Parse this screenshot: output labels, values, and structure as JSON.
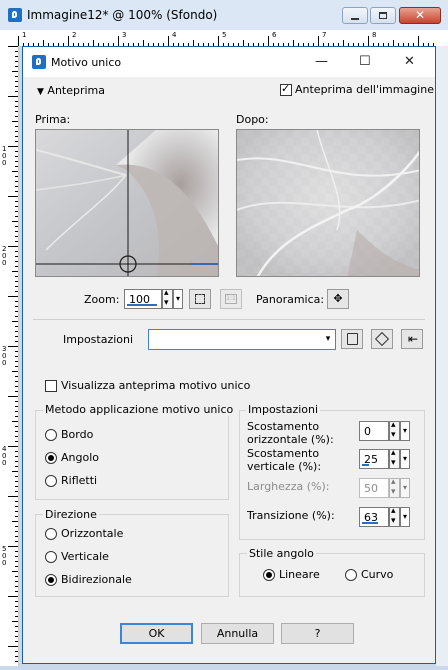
{
  "outer_window": {
    "title": "Immagine12* @ 100% (Sfondo)",
    "close_glyph": "✕"
  },
  "rulers": {
    "top_numbers": [
      "1",
      "2",
      "3",
      "4",
      "5",
      "6",
      "7",
      "8"
    ],
    "left_numbers": [
      "100",
      "200",
      "300",
      "400",
      "500"
    ]
  },
  "dialog": {
    "title": "Motivo unico",
    "controls": {
      "minimize": "—",
      "maximize": "☐",
      "close": "✕"
    },
    "preview_toggle": "Anteprima",
    "image_preview_label": "Anteprima dell'immagine",
    "image_preview_checked": true,
    "before_label": "Prima:",
    "after_label": "Dopo:",
    "zoom_label": "Zoom:",
    "zoom_value": "100",
    "pan_label": "Panoramica:",
    "presets_label": "Impostazioni",
    "presets_value": "",
    "show_tile_preview_label": "Visualizza anteprima motivo unico",
    "show_tile_preview_checked": false,
    "method_group": {
      "title": "Metodo applicazione motivo unico",
      "options": [
        "Bordo",
        "Angolo",
        "Rifletti"
      ],
      "selected": "Angolo"
    },
    "direction_group": {
      "title": "Direzione",
      "options": [
        "Orizzontale",
        "Verticale",
        "Bidirezionale"
      ],
      "selected": "Bidirezionale"
    },
    "settings_group": {
      "title": "Impostazioni",
      "h_offset_label": "Scostamento orizzontale (%):",
      "h_offset_line1": "Scostamento",
      "h_offset_line2": "orizzontale (%):",
      "h_offset_value": "0",
      "h_offset_fill": 0.0,
      "v_offset_line1": "Scostamento",
      "v_offset_line2": "verticale (%):",
      "v_offset_value": "25",
      "v_offset_fill": 0.25,
      "width_label": "Larghezza (%):",
      "width_value": "50",
      "transition_label": "Transizione (%):",
      "transition_value": "63",
      "transition_fill": 0.63
    },
    "corner_group": {
      "title": "Stile angolo",
      "options": [
        "Lineare",
        "Curvo"
      ],
      "selected": "Lineare"
    },
    "buttons": {
      "ok": "OK",
      "cancel": "Annulla",
      "help": "?"
    }
  },
  "colors": {
    "accent": "#3c86d3",
    "titlebar_outer": "#dbe7f4",
    "dialog_bg": "#f0f0f0"
  },
  "icons": [
    "app-icon",
    "minimize-icon",
    "maximize-icon",
    "close-icon",
    "triangle-down-icon",
    "fit-zoom-icon",
    "actual-size-icon",
    "pan-move-icon",
    "save-preset-icon",
    "cube-icon",
    "reset-icon"
  ]
}
